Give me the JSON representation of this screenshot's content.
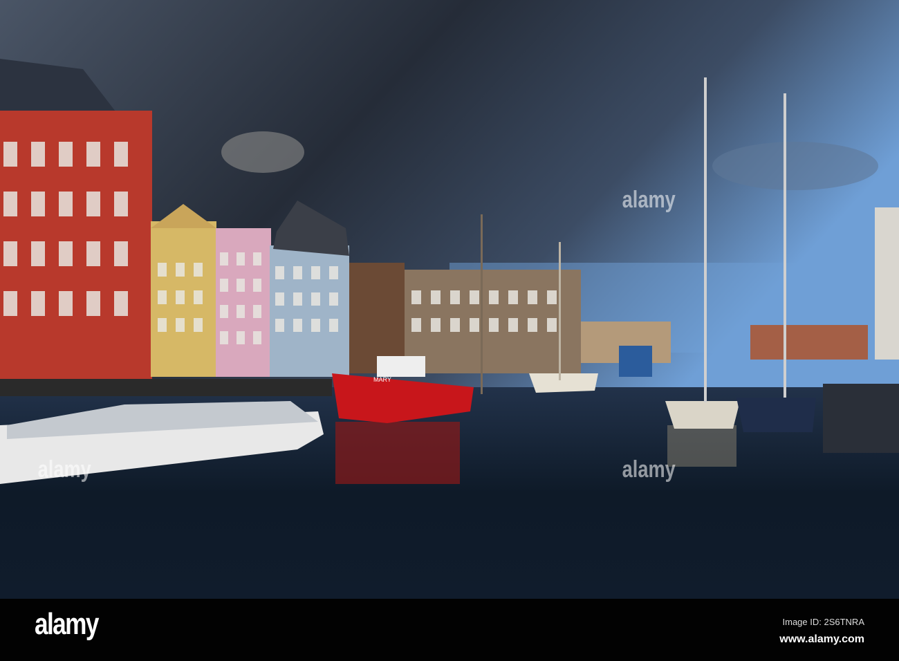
{
  "photo": {
    "description_label": "Nyhavn canal with colorful houses and boats",
    "boat_name": "MARY",
    "colors": {
      "sky_dark": "#2f3744",
      "sky_blue": "#6f9fd6",
      "water": "#0e1a28",
      "red_building": "#b8392c",
      "red_boat": "#c8161b"
    }
  },
  "watermark": {
    "text": "alamy"
  },
  "footer": {
    "logo": "alamy",
    "image_id": "Image ID: 2S6TNRA",
    "url": "www.alamy.com"
  }
}
